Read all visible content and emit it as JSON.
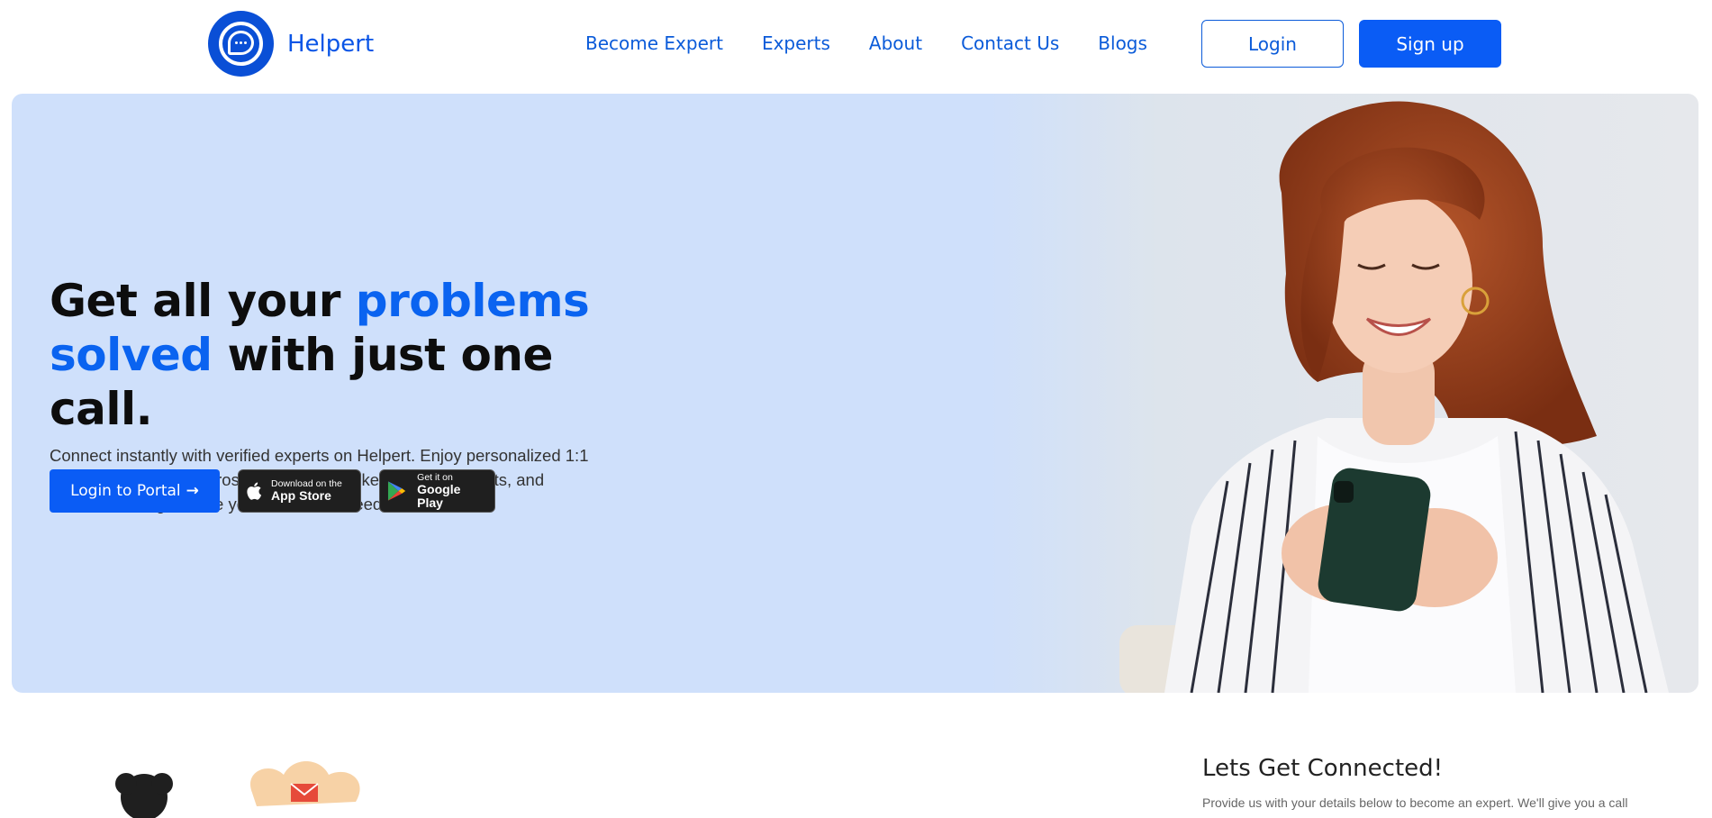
{
  "brand": {
    "name": "Helpert",
    "color": "#0a55e6"
  },
  "nav": {
    "links": [
      "Become Expert",
      "Experts",
      "About",
      "Contact Us",
      "Blogs"
    ],
    "login_label": "Login",
    "signup_label": "Sign up"
  },
  "hero": {
    "title_part1": "Get all your ",
    "title_accent1": "problems",
    "title_accent2": "solved",
    "title_part2": " with just one call.",
    "description": "Connect instantly with verified experts on Helpert. Enjoy personalized 1:1 video appointments across various fields like health, tech, arts, and more. Get the guidance you need to succeed!",
    "portal_button": "Login to Portal",
    "appstore_small": "Download on the",
    "appstore_big": "App Store",
    "gplay_small": "Get it on",
    "gplay_big": "Google Play",
    "accent_color": "#0a63f0"
  },
  "connect": {
    "title": "Lets Get Connected!",
    "description": "Provide us with your details below to become an expert. We'll give you a call"
  }
}
